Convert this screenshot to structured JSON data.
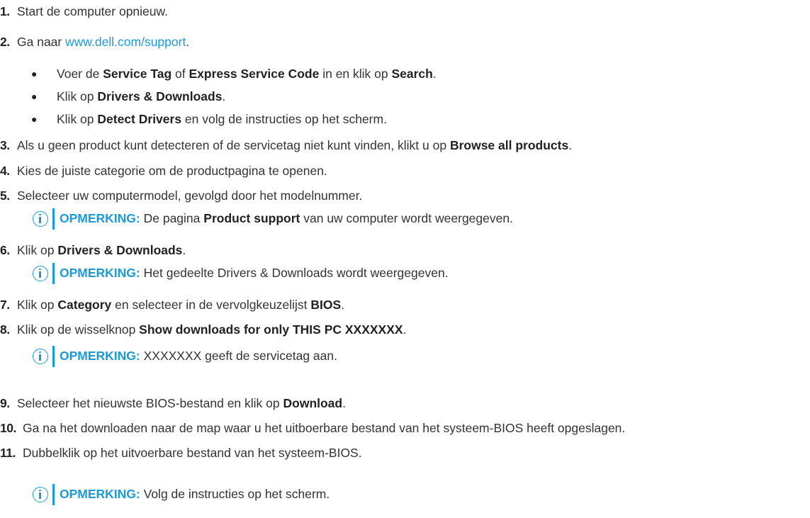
{
  "steps": [
    {
      "num": "1.",
      "text": "Start de computer opnieuw."
    },
    {
      "num": "2.",
      "pre": "Ga naar ",
      "link": "www.dell.com/support",
      "post": "."
    },
    {
      "num": "3.",
      "pre": "Als u geen product kunt detecteren of de servicetag niet kunt vinden, klikt u op ",
      "bold": "Browse all products",
      "post": "."
    },
    {
      "num": "4.",
      "text": "Kies de juiste categorie om de productpagina te openen."
    },
    {
      "num": "5.",
      "text": "Selecteer uw computermodel, gevolgd door het modelnummer."
    },
    {
      "num": "6.",
      "pre": "Klik op ",
      "bold": "Drivers & Downloads",
      "post": "."
    },
    {
      "num": "7.",
      "pre": "Klik op ",
      "bold": "Category",
      "mid": " en selecteer in de vervolgkeuzelijst ",
      "bold2": "BIOS",
      "post": "."
    },
    {
      "num": "8.",
      "pre": "Klik op de wisselknop ",
      "bold": "Show downloads for only THIS PC XXXXXXX",
      "post": "."
    },
    {
      "num": "9.",
      "pre": "Selecteer het nieuwste BIOS-bestand en klik op ",
      "bold": "Download",
      "post": "."
    },
    {
      "num": "10.",
      "text": "Ga na het downloaden naar de map waar u het uitboerbare bestand van het systeem-BIOS heeft opgeslagen."
    },
    {
      "num": "11.",
      "text": "Dubbelklik op het uitvoerbare bestand van het systeem-BIOS."
    }
  ],
  "substeps": [
    {
      "pre": "Voer de ",
      "bold": "Service Tag",
      "mid": " of ",
      "bold2": "Express Service Code",
      "mid2": " in en klik op ",
      "bold3": "Search",
      "post": "."
    },
    {
      "pre": "Klik op ",
      "bold": "Drivers & Downloads",
      "post": "."
    },
    {
      "pre": "Klik op ",
      "bold": "Detect Drivers",
      "post": " en volg de instructies op het scherm."
    }
  ],
  "bullet_char": "●",
  "notes": [
    {
      "label": "OPMERKING:",
      "pre": " De pagina ",
      "bold": "Product support",
      "post": " van uw computer wordt weergegeven."
    },
    {
      "label": "OPMERKING:",
      "text": " Het gedeelte Drivers & Downloads wordt weergegeven."
    },
    {
      "label": "OPMERKING:",
      "text": " XXXXXXX geeft de servicetag aan."
    },
    {
      "label": "OPMERKING:",
      "text": " Volg de instructies op het scherm."
    }
  ],
  "colors": {
    "accent": "#1a9bd7",
    "text": "#333333"
  },
  "icons": {
    "note": "info-icon"
  }
}
